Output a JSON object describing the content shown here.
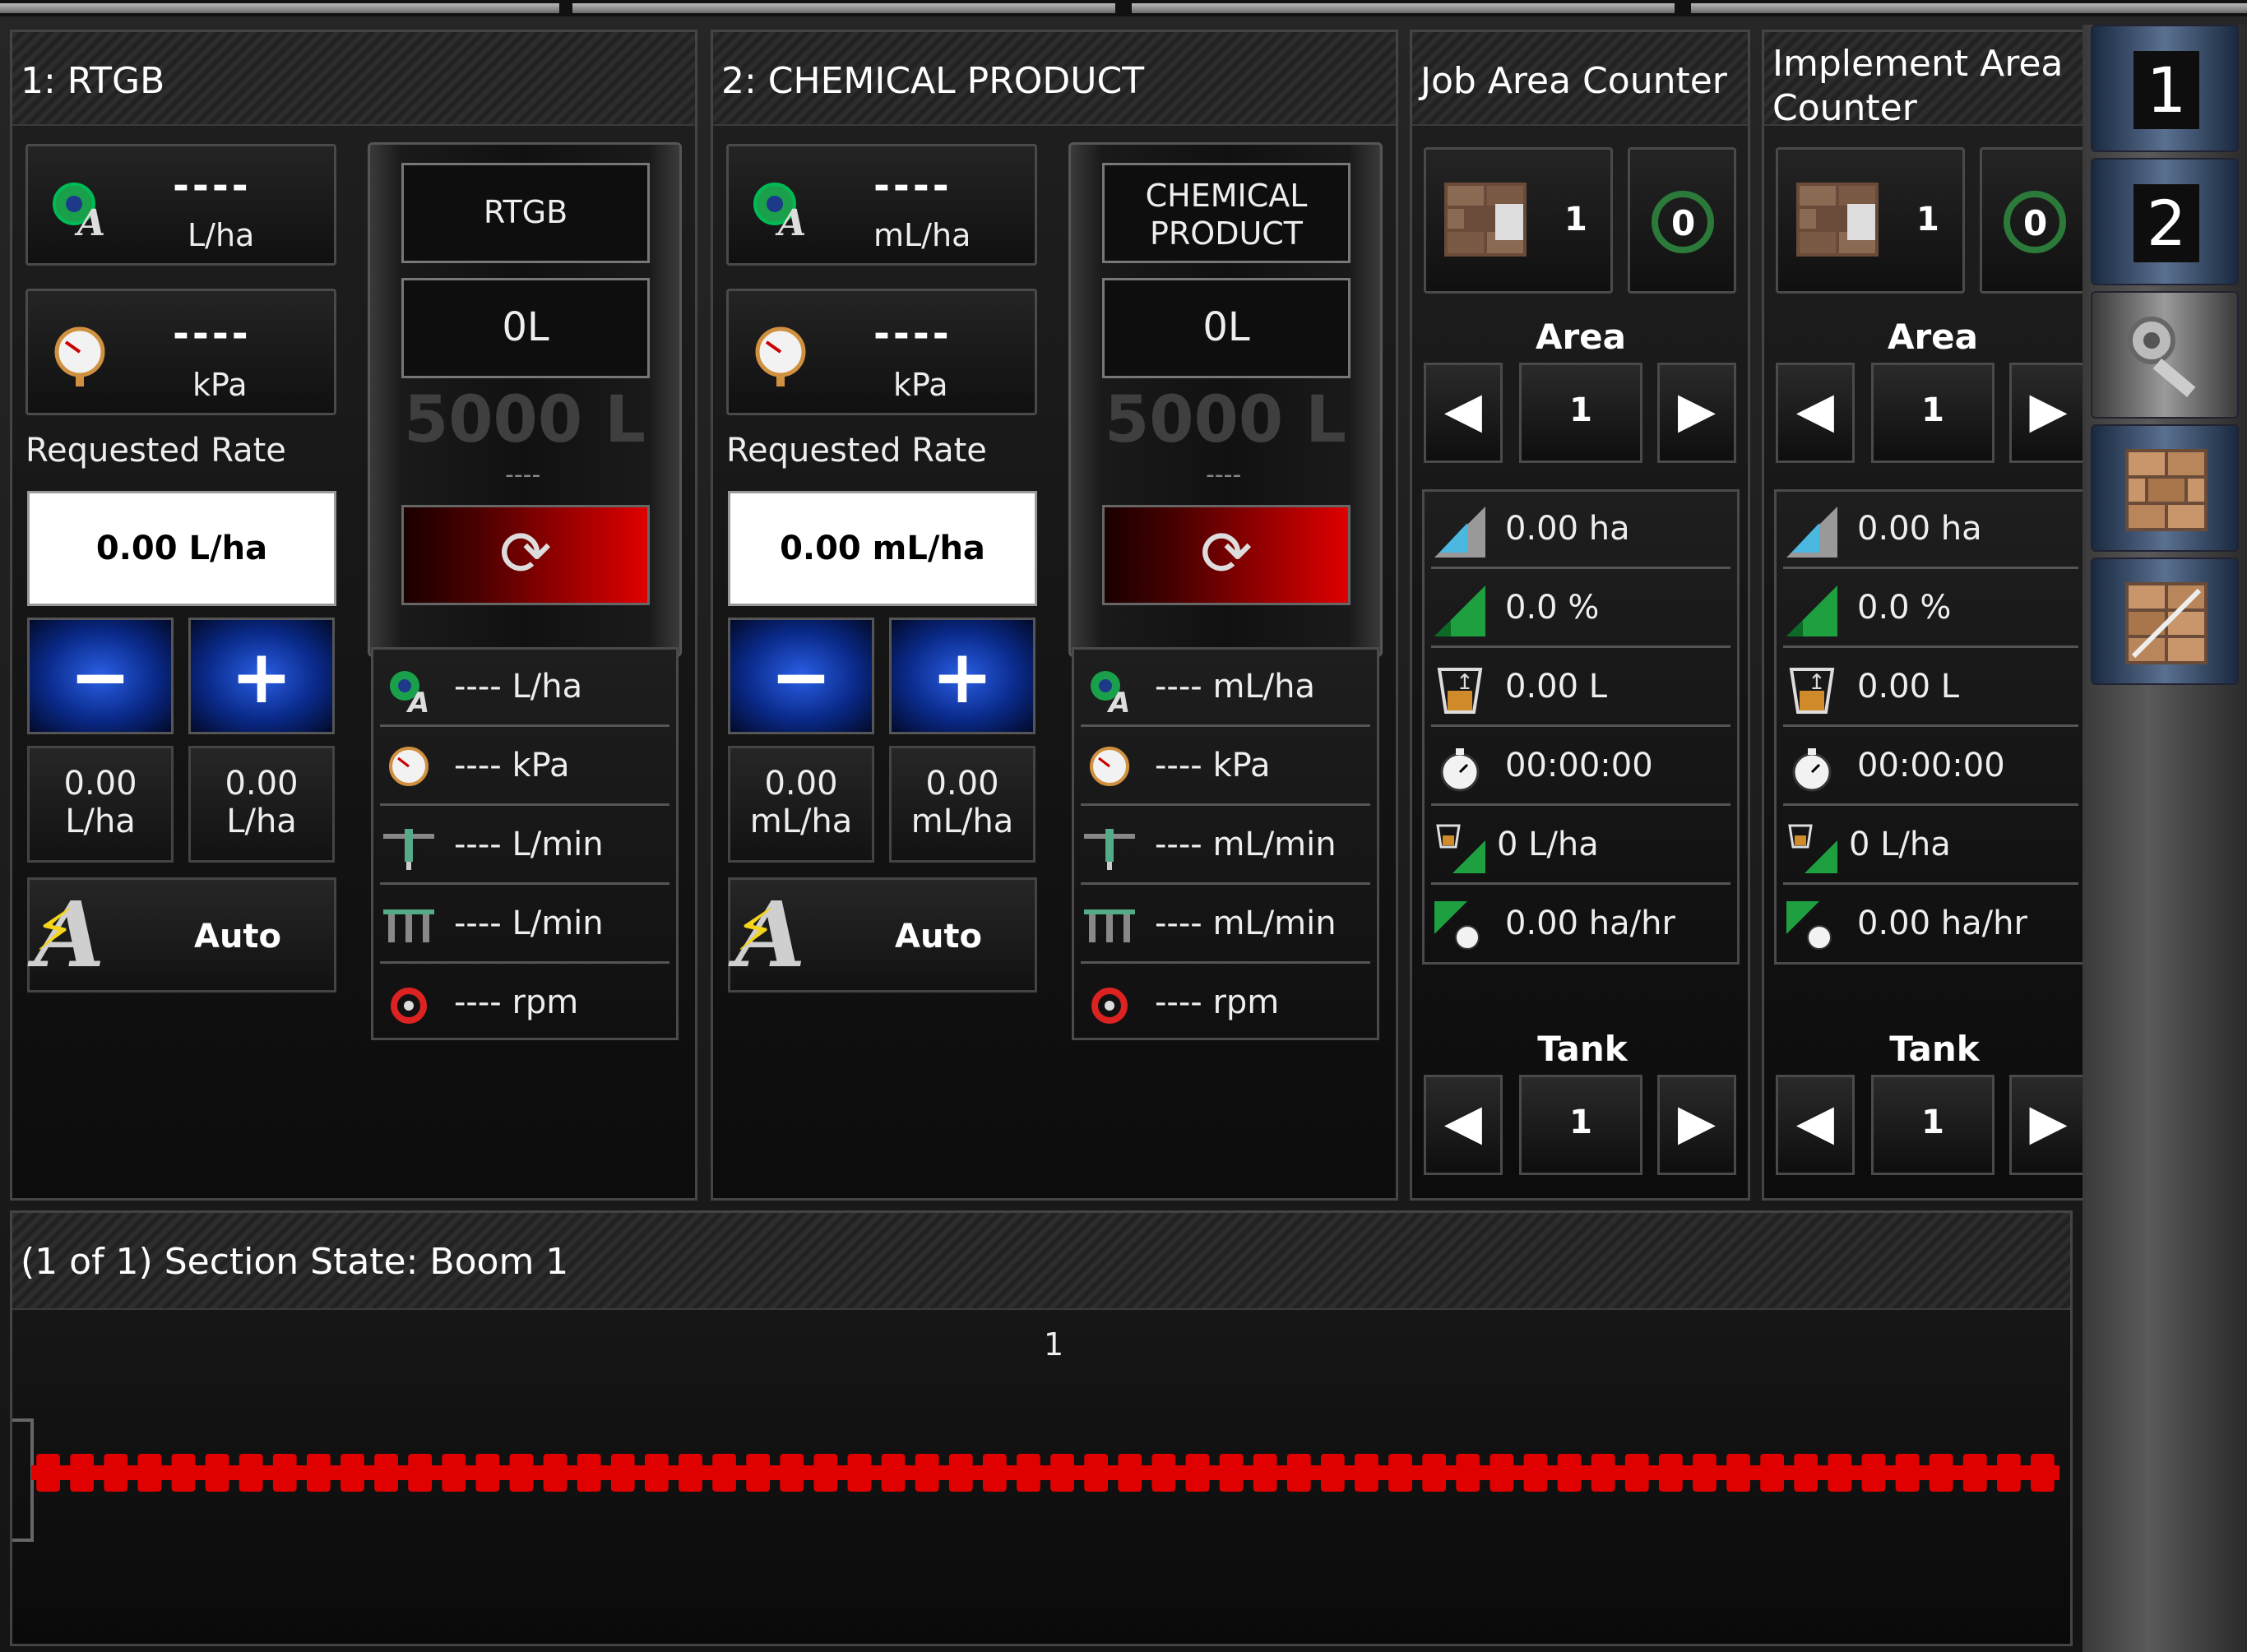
{
  "products": [
    {
      "title": "1: RTGB",
      "rate_actual": "----",
      "rate_unit": "L/ha",
      "pressure": "----",
      "pressure_unit": "kPa",
      "requested_label": "Requested Rate",
      "requested_value": "0.00 L/ha",
      "minus": "−",
      "plus": "+",
      "preset1": "0.00\nL/ha",
      "preset2": "0.00\nL/ha",
      "auto_label": "Auto",
      "tank_name": "RTGB",
      "tank_fill": "0L",
      "tank_capacity": "5000 L",
      "tank_dash": "----",
      "list": [
        "---- L/ha",
        "---- kPa",
        "---- L/min",
        "---- L/min",
        "---- rpm"
      ]
    },
    {
      "title": "2: CHEMICAL PRODUCT",
      "rate_actual": "----",
      "rate_unit": "mL/ha",
      "pressure": "----",
      "pressure_unit": "kPa",
      "requested_label": "Requested Rate",
      "requested_value": "0.00 mL/ha",
      "minus": "−",
      "plus": "+",
      "preset1": "0.00\nmL/ha",
      "preset2": "0.00\nmL/ha",
      "auto_label": "Auto",
      "tank_name": "CHEMICAL\nPRODUCT",
      "tank_fill": "0L",
      "tank_capacity": "5000 L",
      "tank_dash": "----",
      "list": [
        "---- mL/ha",
        "---- kPa",
        "---- mL/min",
        "---- mL/min",
        "---- rpm"
      ]
    }
  ],
  "counters": [
    {
      "title": "Job Area Counter",
      "field_num": "1",
      "reset_icon_label": "0",
      "area_label": "Area",
      "area_value": "1",
      "stats": [
        "0.00 ha",
        "0.0 %",
        "0.00 L",
        "00:00:00",
        "0 L/ha",
        "0.00 ha/hr"
      ],
      "tank_label": "Tank",
      "tank_value": "1"
    },
    {
      "title": "Implement Area Counter",
      "field_num": "1",
      "reset_icon_label": "0",
      "area_label": "Area",
      "area_value": "1",
      "stats": [
        "0.00 ha",
        "0.0 %",
        "0.00 L",
        "00:00:00",
        "0 L/ha",
        "0.00 ha/hr"
      ],
      "tank_label": "Tank",
      "tank_value": "1"
    }
  ],
  "section": {
    "title": "(1 of 1) Section State: Boom 1",
    "boom_label": "1",
    "nozzle_count": 60,
    "nozzle_color": "#e00000"
  },
  "sidebar": {
    "buttons": [
      {
        "label": "1",
        "icon": "screen-1-icon"
      },
      {
        "label": "2",
        "icon": "screen-2-icon"
      },
      {
        "label": "",
        "icon": "settings-wrench-icon"
      },
      {
        "label": "",
        "icon": "field-bricks-icon"
      },
      {
        "label": "",
        "icon": "field-edit-icon"
      }
    ]
  },
  "colors": {
    "accent_blue": "#1a4fd6",
    "warning_red": "#e00000",
    "auto_yellow": "#f4d51a"
  }
}
